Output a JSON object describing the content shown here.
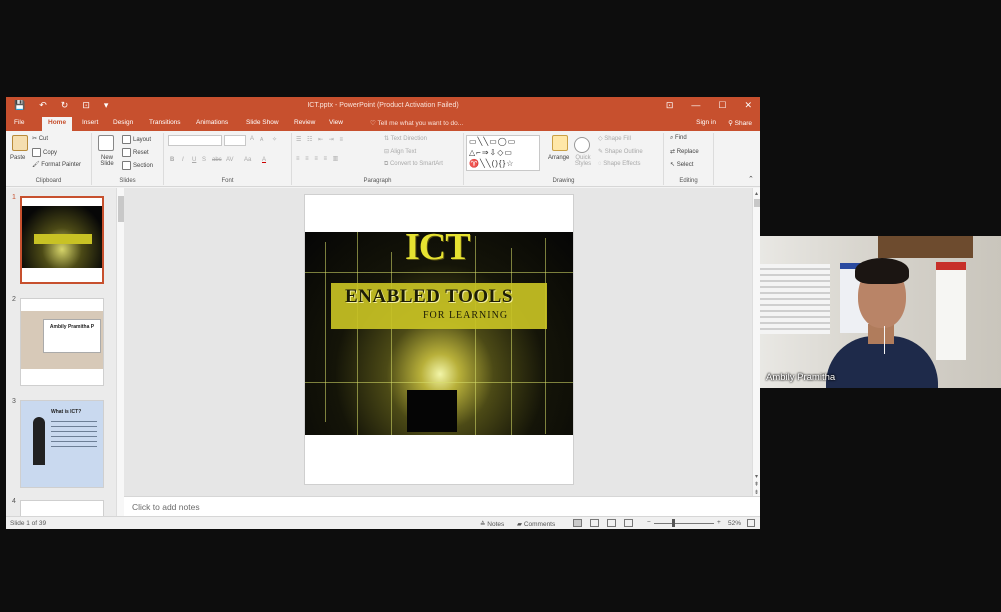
{
  "window": {
    "title": "ICT.pptx - PowerPoint (Product Activation Failed)",
    "quick_access": [
      "💾",
      "↶",
      "↻",
      "⊡",
      "▾"
    ],
    "window_controls": [
      "⊡",
      "—",
      "☐",
      "✕"
    ]
  },
  "ribbon_tabs": {
    "items": [
      "File",
      "Home",
      "Insert",
      "Design",
      "Transitions",
      "Animations",
      "Slide Show",
      "Review",
      "View"
    ],
    "active": "Home",
    "tell_me": "Tell me what you want to do...",
    "sign_in": "Sign in",
    "share": "Share"
  },
  "ribbon": {
    "clipboard": {
      "paste": "Paste",
      "cut": "Cut",
      "copy": "Copy",
      "format_painter": "Format Painter",
      "label": "Clipboard"
    },
    "slides": {
      "new_slide": "New Slide",
      "layout": "Layout",
      "reset": "Reset",
      "section": "Section",
      "label": "Slides"
    },
    "font": {
      "label": "Font",
      "bold": "B",
      "italic": "I",
      "underline": "U",
      "strike": "S",
      "shadow": "abc",
      "spacing": "AV",
      "case": "Aa",
      "color": "A",
      "grow": "A",
      "shrink": "A"
    },
    "paragraph": {
      "text_direction": "Text Direction",
      "align_text": "Align Text",
      "convert_smartart": "Convert to SmartArt",
      "label": "Paragraph"
    },
    "drawing": {
      "shapes": "▭╲╲▭◯▭\n△⌐⇒⇩◇▭\n♈╲╲(){}☆",
      "arrange": "Arrange",
      "quick_styles": "Quick Styles",
      "shape_fill": "Shape Fill",
      "shape_outline": "Shape Outline",
      "shape_effects": "Shape Effects",
      "label": "Drawing"
    },
    "editing": {
      "find": "Find",
      "replace": "Replace",
      "select": "Select",
      "label": "Editing"
    }
  },
  "thumbnails": [
    {
      "number": "1",
      "selected": true
    },
    {
      "number": "2",
      "text": "Ambily Pramitha P"
    },
    {
      "number": "3",
      "text": "What is ICT?"
    },
    {
      "number": "4"
    }
  ],
  "slide": {
    "title": "ICT",
    "line1": "ENABLED TOOLS",
    "line2": "FOR LEARNING"
  },
  "notes_placeholder": "Click to add notes",
  "status": {
    "slide_indicator": "Slide 1 of 39",
    "notes": "Notes",
    "comments": "Comments",
    "zoom": "52%",
    "zoom_minus": "−",
    "zoom_plus": "+"
  },
  "participant": {
    "name": "Ambily Pramitha"
  }
}
